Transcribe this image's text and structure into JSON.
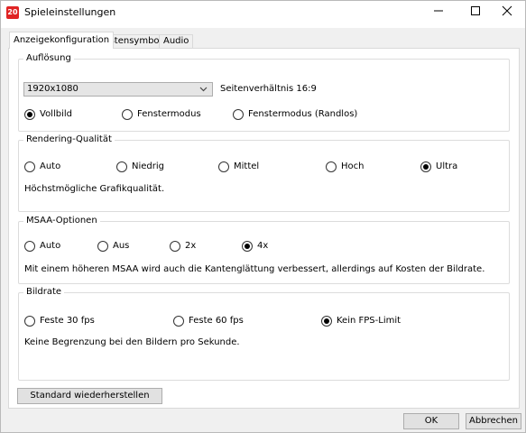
{
  "window": {
    "title": "Spieleinstellungen",
    "app_icon_text": "20"
  },
  "tabs": [
    {
      "label": "Anzeigekonfiguration",
      "active": true
    },
    {
      "label": "Tastensymbole",
      "active": false
    },
    {
      "label": "Audio",
      "active": false
    }
  ],
  "resolution": {
    "title": "Auflösung",
    "selected": "1920x1080",
    "aspect_ratio": "Seitenverhältnis 16:9",
    "modes": [
      {
        "label": "Vollbild",
        "checked": true
      },
      {
        "label": "Fenstermodus",
        "checked": false
      },
      {
        "label": "Fenstermodus (Randlos)",
        "checked": false
      }
    ]
  },
  "quality": {
    "title": "Rendering-Qualität",
    "options": [
      {
        "label": "Auto",
        "checked": false
      },
      {
        "label": "Niedrig",
        "checked": false
      },
      {
        "label": "Mittel",
        "checked": false
      },
      {
        "label": "Hoch",
        "checked": false
      },
      {
        "label": "Ultra",
        "checked": true
      }
    ],
    "description": "Höchstmögliche Grafikqualität."
  },
  "msaa": {
    "title": "MSAA-Optionen",
    "options": [
      {
        "label": "Auto",
        "checked": false
      },
      {
        "label": "Aus",
        "checked": false
      },
      {
        "label": "2x",
        "checked": false
      },
      {
        "label": "4x",
        "checked": true
      }
    ],
    "description": "Mit einem höheren MSAA wird auch die Kantenglättung verbessert, allerdings auf Kosten der Bildrate."
  },
  "framerate": {
    "title": "Bildrate",
    "options": [
      {
        "label": "Feste 30 fps",
        "checked": false
      },
      {
        "label": "Feste 60 fps",
        "checked": false
      },
      {
        "label": "Kein FPS-Limit",
        "checked": true
      }
    ],
    "description": "Keine Begrenzung bei den Bildern pro Sekunde."
  },
  "buttons": {
    "reset": "Standard wiederherstellen",
    "ok": "OK",
    "cancel": "Abbrechen"
  }
}
